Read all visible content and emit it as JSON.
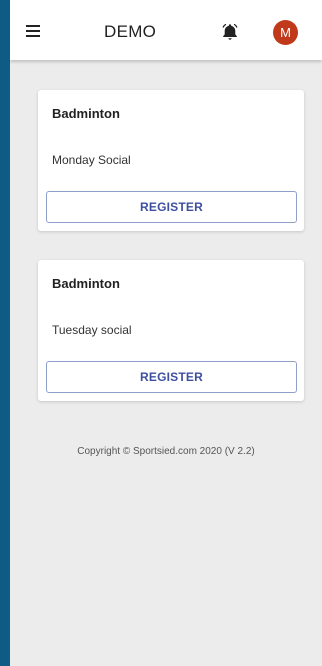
{
  "app": {
    "title": "DEMO"
  },
  "header": {
    "avatar_initial": "M",
    "icons": {
      "menu": "menu-icon",
      "notifications": "bell-icon"
    }
  },
  "events": [
    {
      "sport": "Badminton",
      "name": "Monday Social",
      "button_label": "REGISTER"
    },
    {
      "sport": "Badminton",
      "name": "Tuesday social",
      "button_label": "REGISTER"
    }
  ],
  "footer": {
    "copyright": "Copyright © Sportsied.com 2020 (V 2.2)"
  },
  "colors": {
    "accent": "#3f4fa0",
    "avatar": "#c0391b",
    "side_bar": "#0e5b86"
  }
}
